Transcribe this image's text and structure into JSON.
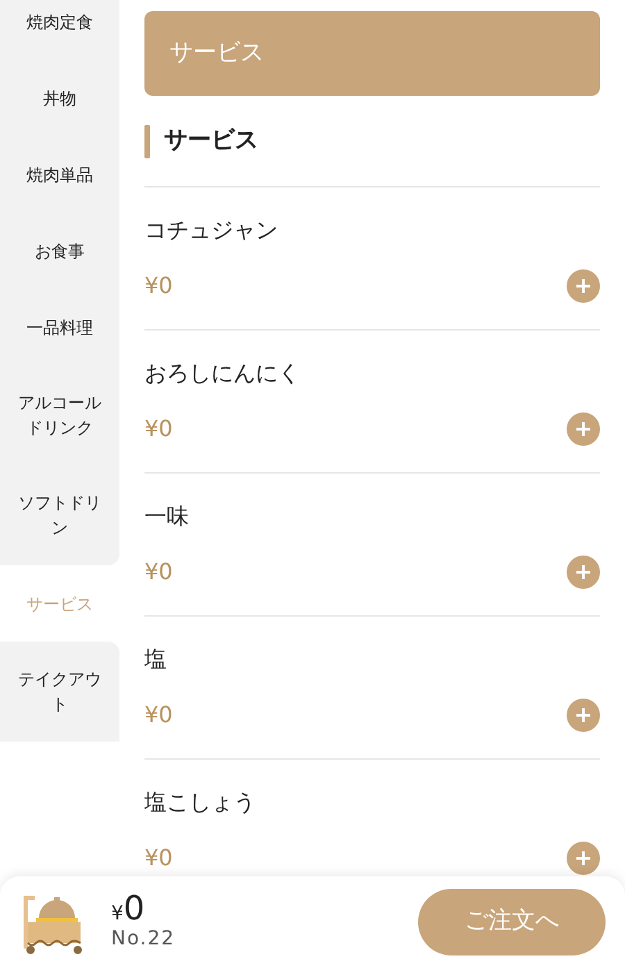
{
  "sidebar": {
    "items": [
      {
        "label": "焼肉定食",
        "selected": false
      },
      {
        "label": "丼物",
        "selected": false
      },
      {
        "label": "焼肉単品",
        "selected": false
      },
      {
        "label": "お食事",
        "selected": false
      },
      {
        "label": "一品料理",
        "selected": false
      },
      {
        "label": "アルコールドリンク",
        "selected": false
      },
      {
        "label": "ソフトドリン",
        "selected": false
      },
      {
        "label": "サービス",
        "selected": true
      },
      {
        "label": "テイクアウト",
        "selected": false
      }
    ]
  },
  "banner": {
    "title": "サービス"
  },
  "section": {
    "title": "サービス"
  },
  "products": [
    {
      "name": "コチュジャン",
      "price": "¥0"
    },
    {
      "name": "おろしにんにく",
      "price": "¥0"
    },
    {
      "name": "一味",
      "price": "¥0"
    },
    {
      "name": "塩",
      "price": "¥0"
    },
    {
      "name": "塩こしょう",
      "price": "¥0"
    }
  ],
  "footer": {
    "total": "0",
    "currency": "¥",
    "table": "No.22",
    "order_button": "ご注文へ"
  }
}
